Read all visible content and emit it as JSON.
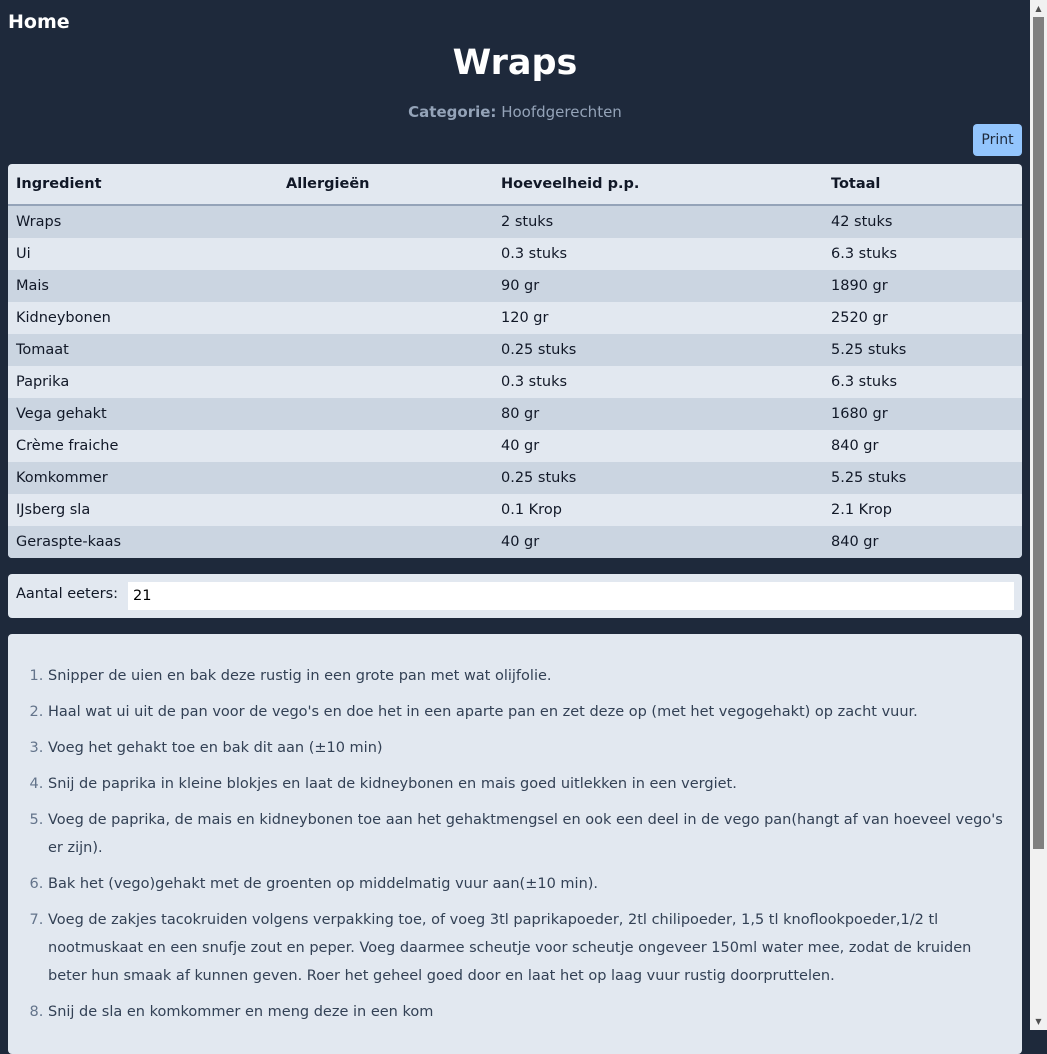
{
  "nav": {
    "home_label": "Home"
  },
  "recipe": {
    "title": "Wraps",
    "category_label": "Categorie:",
    "category_value": "Hoofdgerechten"
  },
  "toolbar": {
    "print_label": "Print"
  },
  "table": {
    "headers": [
      "Ingredient",
      "Allergieën",
      "Hoeveelheid p.p.",
      "Totaal"
    ],
    "rows": [
      {
        "ingredient": "Wraps",
        "allergens": "",
        "pp": "2 stuks",
        "total": "42 stuks"
      },
      {
        "ingredient": "Ui",
        "allergens": "",
        "pp": "0.3 stuks",
        "total": "6.3 stuks"
      },
      {
        "ingredient": "Mais",
        "allergens": "",
        "pp": "90 gr",
        "total": "1890 gr"
      },
      {
        "ingredient": "Kidneybonen",
        "allergens": "",
        "pp": "120 gr",
        "total": "2520 gr"
      },
      {
        "ingredient": "Tomaat",
        "allergens": "",
        "pp": "0.25 stuks",
        "total": "5.25 stuks"
      },
      {
        "ingredient": "Paprika",
        "allergens": "",
        "pp": "0.3 stuks",
        "total": "6.3 stuks"
      },
      {
        "ingredient": "Vega gehakt",
        "allergens": "",
        "pp": "80 gr",
        "total": "1680 gr"
      },
      {
        "ingredient": "Crème fraiche",
        "allergens": "",
        "pp": "40 gr",
        "total": "840 gr"
      },
      {
        "ingredient": "Komkommer",
        "allergens": "",
        "pp": "0.25 stuks",
        "total": "5.25 stuks"
      },
      {
        "ingredient": "IJsberg sla",
        "allergens": "",
        "pp": "0.1 Krop",
        "total": "2.1 Krop"
      },
      {
        "ingredient": "Geraspte-kaas",
        "allergens": "",
        "pp": "40 gr",
        "total": "840 gr"
      }
    ]
  },
  "eaters": {
    "label": "Aantal eeters:",
    "value": "21"
  },
  "steps": [
    "Snipper de uien en bak deze rustig in een grote pan met wat olijfolie.",
    "Haal wat ui uit de pan voor de vego's en doe het in een aparte pan en zet deze op (met het vegogehakt) op zacht vuur.",
    "Voeg het gehakt toe en bak dit aan (±10 min)",
    "Snij de paprika in kleine blokjes en laat de kidneybonen en mais goed uitlekken in een vergiet.",
    "Voeg de paprika, de mais en kidneybonen toe aan het gehaktmengsel en ook een deel in de vego pan(hangt af van hoeveel vego's er zijn).",
    "Bak het (vego)gehakt met de groenten op middelmatig vuur aan(±10 min).",
    "Voeg de zakjes tacokruiden volgens verpakking toe, of voeg 3tl paprikapoeder, 2tl chilipoeder, 1,5 tl knoflookpoeder,1/2 tl nootmuskaat en een snufje zout en peper. Voeg daarmee scheutje voor scheutje ongeveer 150ml water mee, zodat de kruiden beter hun smaak af kunnen geven. Roer het geheel goed door en laat het op laag vuur rustig doorpruttelen.",
    "Snij de sla en komkommer en meng deze in een kom"
  ]
}
